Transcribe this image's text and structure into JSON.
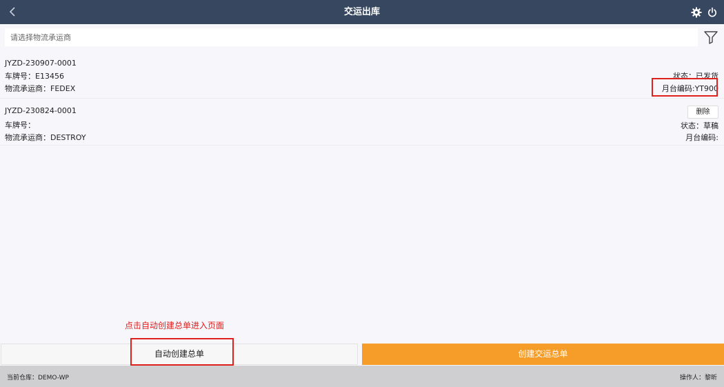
{
  "header": {
    "title": "交运出库"
  },
  "search": {
    "placeholder": "请选择物流承运商"
  },
  "orders": [
    {
      "code": "JYZD-230907-0001",
      "plate": "车牌号：E13456",
      "carrier": "物流承运商：FEDEX",
      "status": "状态：已发货",
      "dock": "月台编码:YT900"
    },
    {
      "code": "JYZD-230824-0001",
      "plate": "车牌号：",
      "carrier": "物流承运商：DESTROY",
      "delete_label": "删除",
      "status": "状态：草稿",
      "dock": "月台编码:"
    }
  ],
  "annotation": "点击自动创建总单进入页面",
  "buttons": {
    "auto_create": "自动创建总单",
    "create": "创建交运总单"
  },
  "footer": {
    "warehouse": "当前仓库：DEMO-WP",
    "operator": "操作人：黎昕"
  },
  "colors": {
    "header_bg": "#36475f",
    "accent": "#f59d28",
    "highlight": "#e0201d"
  },
  "icons": [
    "back-arrow-icon",
    "gear-icon",
    "power-icon",
    "filter-icon"
  ]
}
